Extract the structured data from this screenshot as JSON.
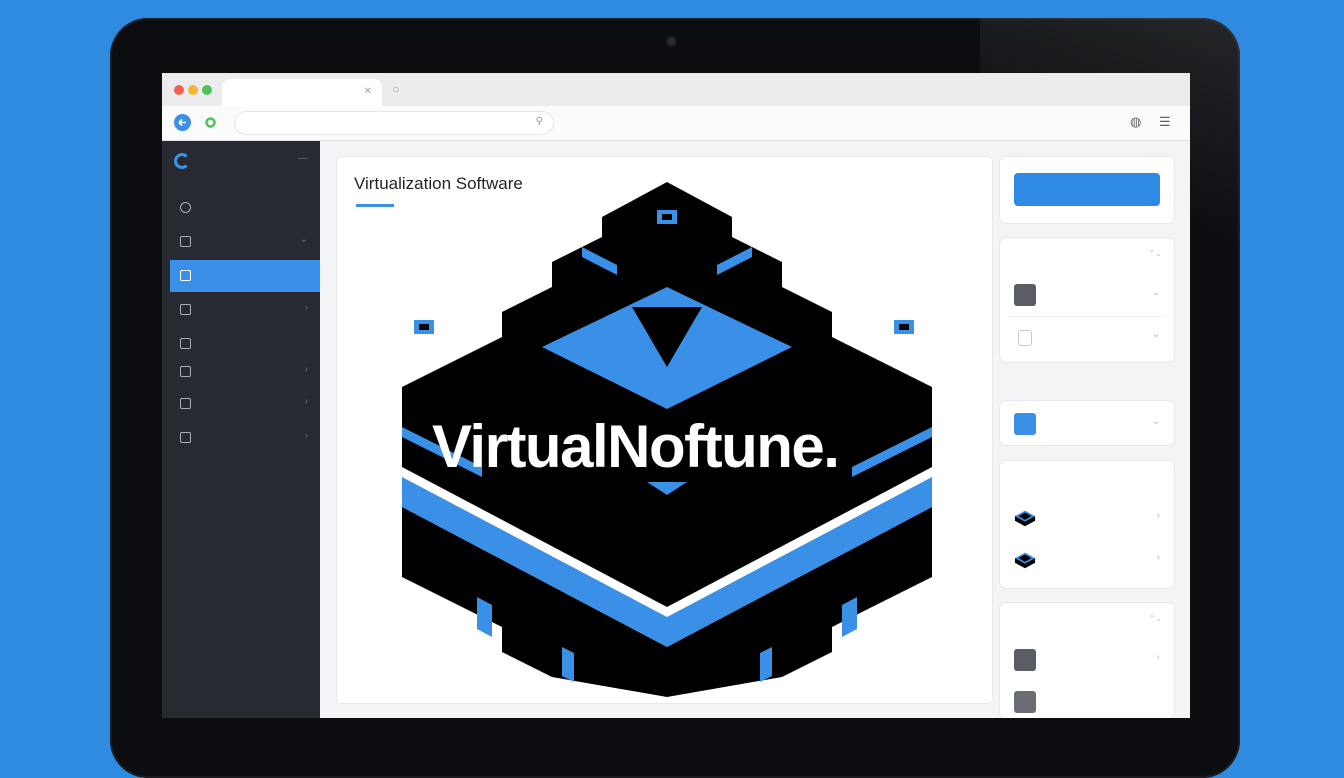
{
  "colors": {
    "background": "#2f8be0",
    "accent": "#3a8fe6",
    "sidebar": "#272b31",
    "logo_blue": "#3a8fe6",
    "logo_black": "#000000"
  },
  "browser": {
    "tab_title": "",
    "address": "",
    "icons": [
      "back-icon",
      "refresh-icon",
      "search-icon",
      "downloads-icon",
      "menu-icon"
    ]
  },
  "sidebar": {
    "brand": "",
    "items": [
      {
        "label": "",
        "icon": "dashboard-icon",
        "active": false,
        "chevron": false
      },
      {
        "label": "",
        "icon": "table-icon",
        "active": false,
        "chevron": true
      },
      {
        "label": "",
        "icon": "layout-icon",
        "active": true,
        "chevron": false
      },
      {
        "label": "",
        "icon": "storage-icon",
        "active": false,
        "chevron": true
      },
      {
        "label": "",
        "icon": "monitor-icon",
        "active": false,
        "chevron": false
      },
      {
        "label": "",
        "icon": "list-icon",
        "active": false,
        "chevron": true
      },
      {
        "label": "",
        "icon": "server-icon",
        "active": false,
        "chevron": true
      },
      {
        "label": "",
        "icon": "document-icon",
        "active": false,
        "chevron": true
      }
    ]
  },
  "main": {
    "title": "Virtualization Software",
    "hero_text": "VirtualNoftune."
  },
  "right_panel": {
    "primary_button": "",
    "section_a": {
      "header": "",
      "rows": [
        {
          "label": ""
        },
        {
          "label": ""
        }
      ]
    },
    "section_b_label": "",
    "section_b_rows": [
      {
        "label": ""
      }
    ],
    "section_c": {
      "header": "",
      "rows": [
        {
          "label": ""
        },
        {
          "label": ""
        }
      ]
    },
    "section_d": {
      "header": "",
      "rows": [
        {
          "label": ""
        },
        {
          "label": ""
        }
      ]
    }
  }
}
